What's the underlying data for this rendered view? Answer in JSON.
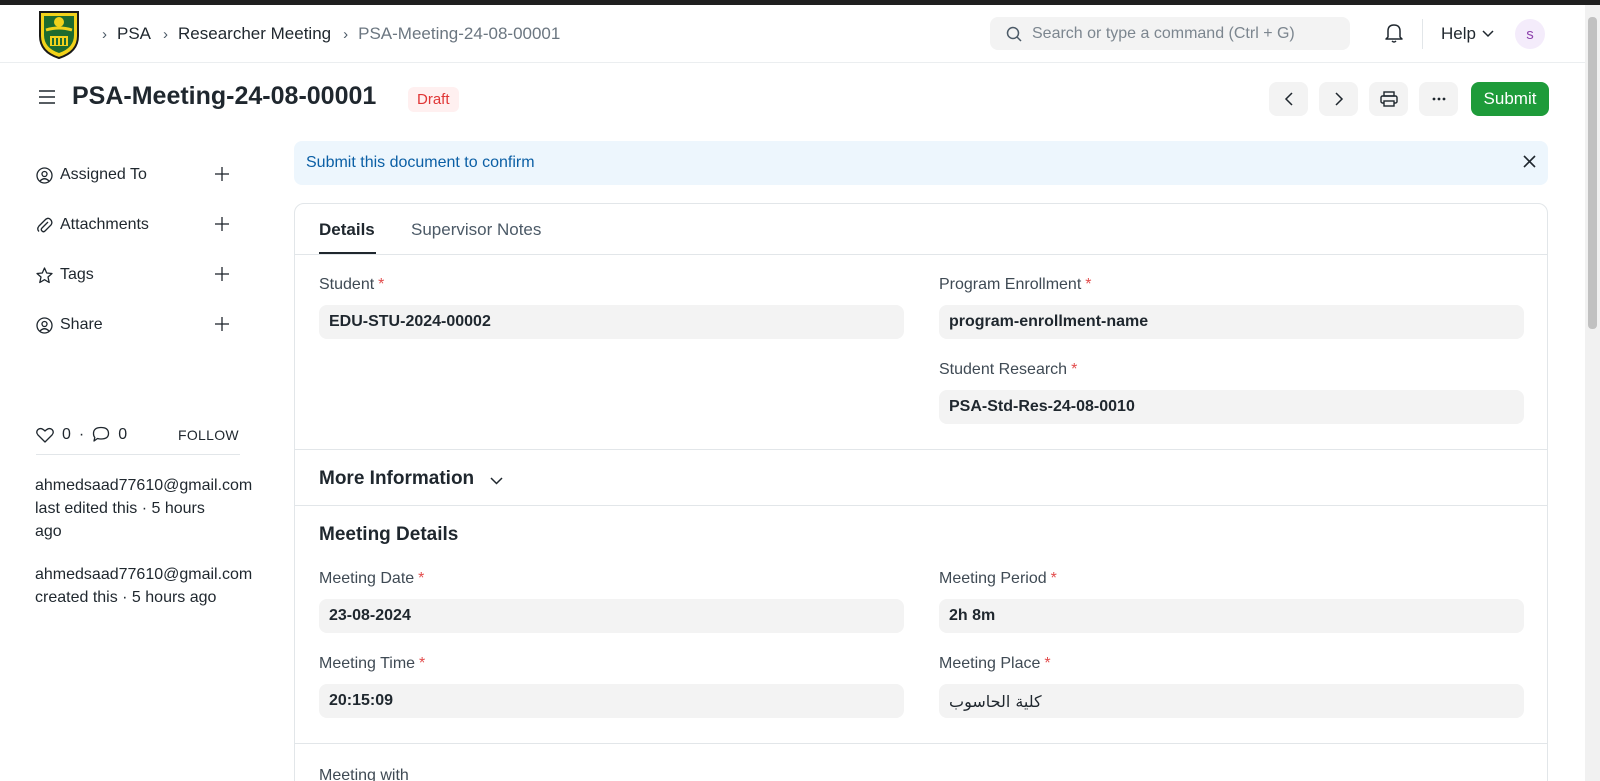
{
  "navbar": {
    "breadcrumbs": [
      "PSA",
      "Researcher Meeting",
      "PSA-Meeting-24-08-00001"
    ],
    "search_placeholder": "Search or type a command (Ctrl + G)",
    "help_label": "Help",
    "avatar_initial": "s"
  },
  "page": {
    "title": "PSA-Meeting-24-08-00001",
    "status": "Draft",
    "submit_label": "Submit"
  },
  "sidebar": {
    "items": [
      {
        "label": "Assigned To",
        "icon": "assign-user-icon"
      },
      {
        "label": "Attachments",
        "icon": "paperclip-icon"
      },
      {
        "label": "Tags",
        "icon": "star-icon"
      },
      {
        "label": "Share",
        "icon": "share-user-icon"
      }
    ],
    "likes": "0",
    "comments": "0",
    "follow_label": "FOLLOW",
    "activity": [
      {
        "user": "ahmedsaad77610@gmail.com",
        "text": "last edited this · 5 hours ago"
      },
      {
        "user": "ahmedsaad77610@gmail.com",
        "text": "created this · 5 hours ago"
      }
    ]
  },
  "alert": {
    "message": "Submit this document to confirm"
  },
  "tabs": [
    "Details",
    "Supervisor Notes"
  ],
  "details": {
    "student_label": "Student",
    "student_value": "EDU-STU-2024-00002",
    "program_enrollment_label": "Program Enrollment",
    "program_enrollment_value": "program-enrollment-name",
    "student_research_label": "Student Research",
    "student_research_value": "PSA-Std-Res-24-08-0010"
  },
  "more_information": "More Information",
  "meeting_details": {
    "title": "Meeting Details",
    "date_label": "Meeting Date",
    "date_value": "23-08-2024",
    "period_label": "Meeting Period",
    "period_value": "2h 8m",
    "time_label": "Meeting Time",
    "time_value": "20:15:09",
    "place_label": "Meeting Place",
    "place_value": "كلية الحاسوب"
  },
  "meeting_with_label": "Meeting with",
  "colors": {
    "accent_green": "#1e9b3a",
    "draft_red": "#e03636",
    "alert_blue": "#0b5fa5"
  }
}
